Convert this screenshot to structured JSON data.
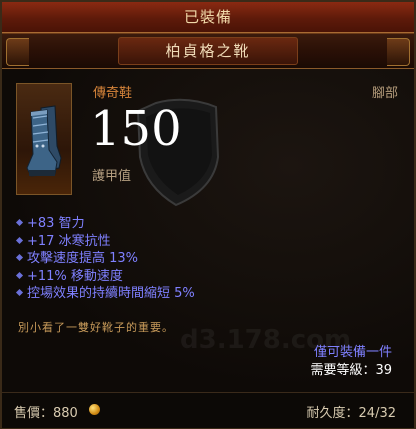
{
  "header": {
    "equipped_label": "已裝備",
    "item_name": "柏貞格之靴"
  },
  "item": {
    "rarity_type": "傳奇鞋",
    "slot": "腳部",
    "icon": "boots-icon",
    "armor_value": "150",
    "armor_label": "護甲值"
  },
  "stats": [
    {
      "text": "+83 智力"
    },
    {
      "text": "+17 冰寒抗性"
    },
    {
      "text": "攻擊速度提高 13%"
    },
    {
      "text": "+11% 移動速度"
    },
    {
      "text": "控場效果的持續時間縮短 5%"
    }
  ],
  "flavor_text": "別小看了一雙好靴子的重要。",
  "watermark": "d3.178.com",
  "requirements": {
    "equip_only": "僅可裝備一件",
    "level_label": "需要等級：39"
  },
  "footer": {
    "price_label": "售價：",
    "price_value": "880",
    "durability_label": "耐久度：",
    "durability_value": "24/32"
  },
  "colors": {
    "magic_stat": "#7f80ff",
    "legendary": "#d6843a",
    "flavor": "#c79a5a"
  }
}
